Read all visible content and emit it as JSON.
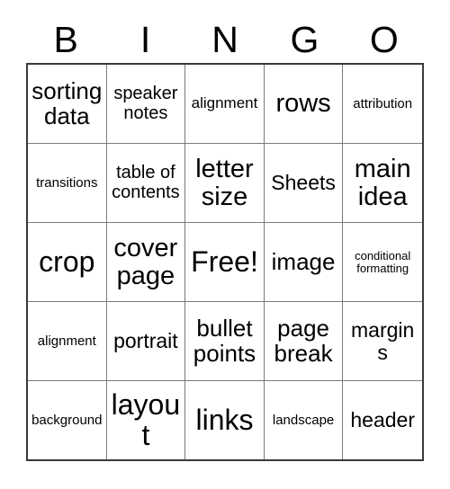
{
  "card": {
    "header_letters": [
      "B",
      "I",
      "N",
      "G",
      "O"
    ],
    "rows": [
      [
        {
          "label": "sorting data",
          "size": "fs-l"
        },
        {
          "label": "speaker notes",
          "size": "fs-m"
        },
        {
          "label": "alignment",
          "size": "fs-sm"
        },
        {
          "label": "rows",
          "size": "fs-xl"
        },
        {
          "label": "attribution",
          "size": "fs-s"
        }
      ],
      [
        {
          "label": "transitions",
          "size": "fs-s"
        },
        {
          "label": "table of contents",
          "size": "fs-m"
        },
        {
          "label": "letter size",
          "size": "fs-xl"
        },
        {
          "label": "Sheets",
          "size": "fs-ml"
        },
        {
          "label": "main idea",
          "size": "fs-xl"
        }
      ],
      [
        {
          "label": "crop",
          "size": "fs-xxl"
        },
        {
          "label": "cover page",
          "size": "fs-xl"
        },
        {
          "label": "Free!",
          "size": "fs-xxl"
        },
        {
          "label": "image",
          "size": "fs-l"
        },
        {
          "label": "conditional formatting",
          "size": "fs-xs"
        }
      ],
      [
        {
          "label": "alignment",
          "size": "fs-s"
        },
        {
          "label": "portrait",
          "size": "fs-ml"
        },
        {
          "label": "bullet points",
          "size": "fs-l"
        },
        {
          "label": "page break",
          "size": "fs-l"
        },
        {
          "label": "margins",
          "size": "fs-ml"
        }
      ],
      [
        {
          "label": "background",
          "size": "fs-s"
        },
        {
          "label": "layout",
          "size": "fs-xxl"
        },
        {
          "label": "links",
          "size": "fs-xxl"
        },
        {
          "label": "landscape",
          "size": "fs-s"
        },
        {
          "label": "header",
          "size": "fs-ml"
        }
      ]
    ]
  },
  "colors": {
    "background": "#ffffff",
    "text": "#000000",
    "outer_border": "#3a3a3a",
    "inner_line": "#7b7b7b"
  }
}
